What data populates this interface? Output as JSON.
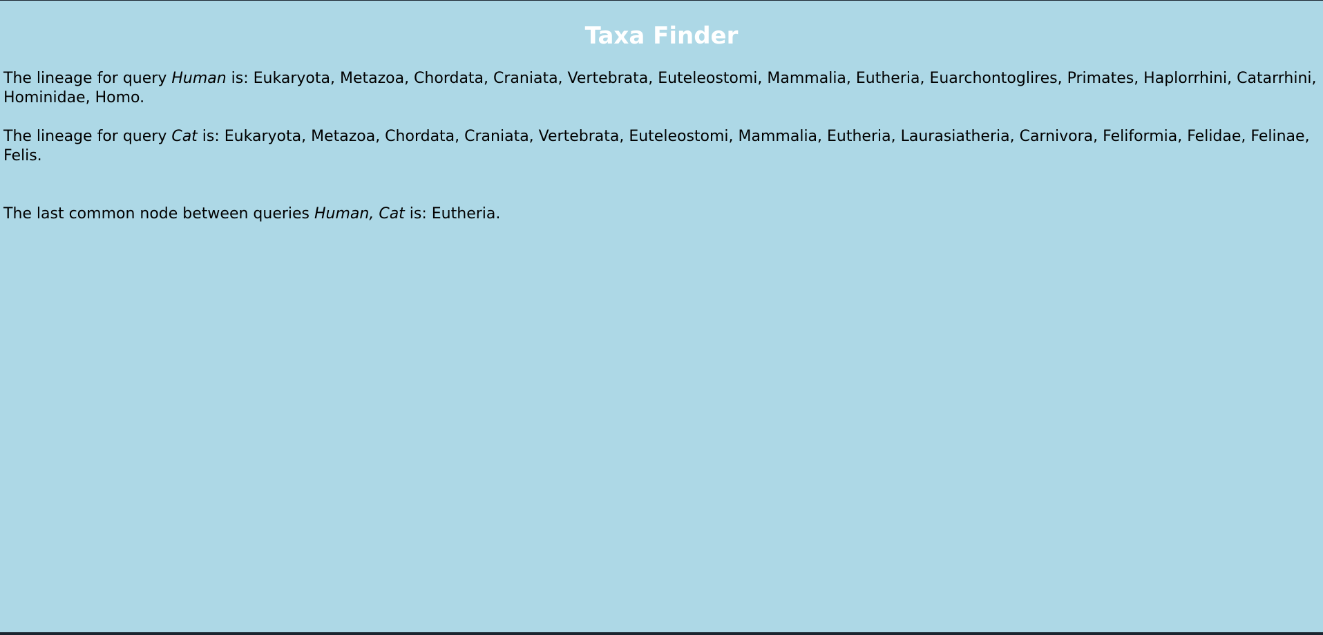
{
  "page": {
    "title": "Taxa Finder"
  },
  "results": {
    "human": {
      "prefix": "The lineage for query ",
      "query": "Human",
      "lineage": " is: Eukaryota, Metazoa, Chordata, Craniata, Vertebrata, Euteleostomi, Mammalia, Eutheria, Euarchontoglires, Primates, Haplorrhini, Catarrhini, Hominidae, Homo."
    },
    "cat": {
      "prefix": "The lineage for query ",
      "query": "Cat",
      "lineage": " is: Eukaryota, Metazoa, Chordata, Craniata, Vertebrata, Euteleostomi, Mammalia, Eutheria, Laurasiatheria, Carnivora, Feliformia, Felidae, Felinae, Felis."
    },
    "common": {
      "prefix": "The last common node between queries ",
      "queries": "Human, Cat",
      "node": " is: Eutheria."
    }
  }
}
